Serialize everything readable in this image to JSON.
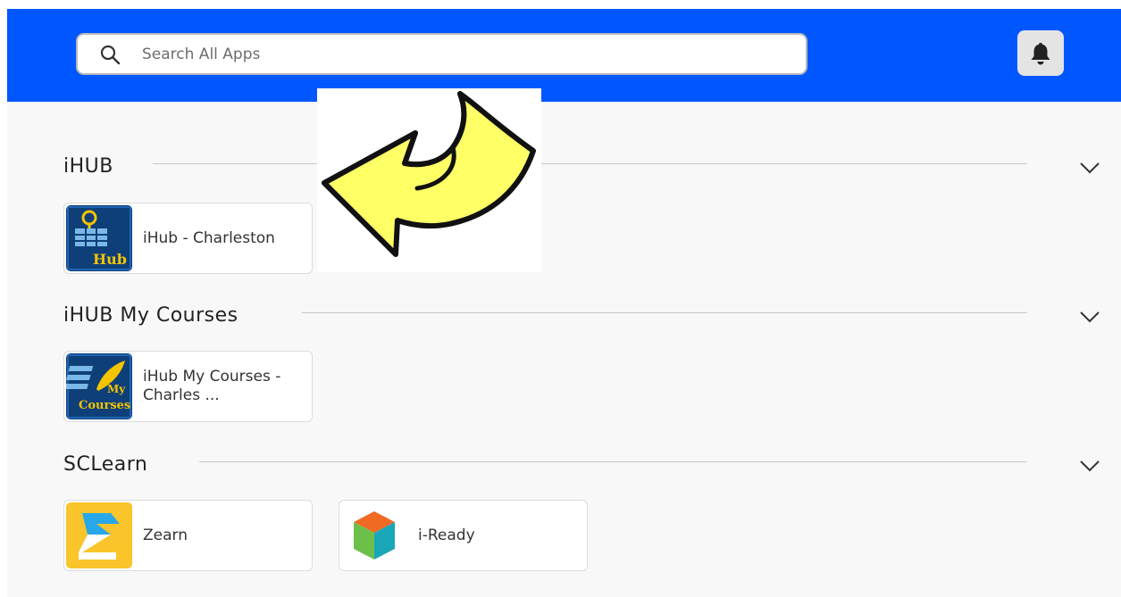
{
  "header": {
    "search_placeholder": "Search All Apps",
    "search_icon": "search-icon",
    "notifications_icon": "bell-icon"
  },
  "sections": [
    {
      "title": "iHUB",
      "apps": [
        {
          "name": "iHub - Charleston",
          "icon": "ihub-logo",
          "icon_text": "Hub"
        }
      ]
    },
    {
      "title": "iHUB My Courses",
      "apps": [
        {
          "name": "iHub My Courses - Charles ...",
          "icon": "ihub-my-courses-logo",
          "icon_text": "My Courses"
        }
      ]
    },
    {
      "title": "SCLearn",
      "apps": [
        {
          "name": "Zearn",
          "icon": "zearn-logo"
        },
        {
          "name": "i-Ready",
          "icon": "iready-cube-logo"
        }
      ]
    }
  ],
  "overlay": {
    "icon": "yellow-curved-arrow"
  },
  "colors": {
    "header_blue": "#0057ff",
    "arrow_yellow": "#ffff66",
    "zearn_yellow": "#f9c52a"
  }
}
